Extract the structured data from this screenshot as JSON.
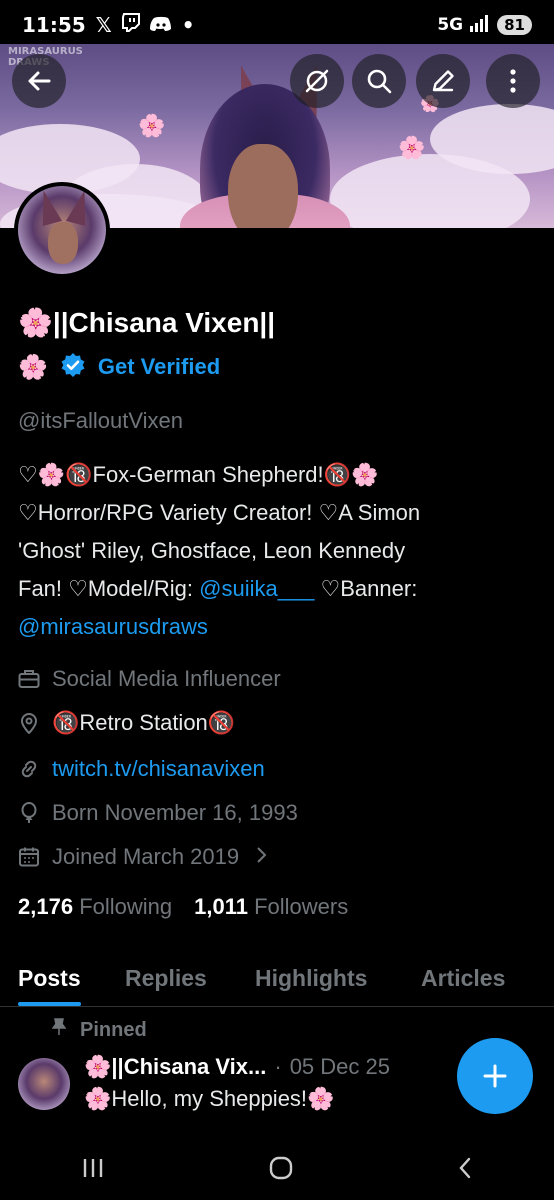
{
  "status_bar": {
    "time": "11:55",
    "network": "5G",
    "battery": "81"
  },
  "banner_watermark": "MIRASAURUS DRAWS",
  "profile": {
    "display_name": "🌸||Chisana Vixen||",
    "name_emoji": "🌸",
    "get_verified": "Get Verified",
    "handle": "@itsFalloutVixen",
    "bio": {
      "line1": "♡🌸🔞Fox-German Shepherd!🔞🌸",
      "line2": "♡Horror/RPG Variety Creator! ♡A Simon",
      "line3": "'Ghost' Riley, Ghostface, Leon Kennedy",
      "line4_pre": "Fan! ♡Model/Rig: ",
      "line4_link": "@suiika___",
      "line4_post": " ♡Banner:",
      "line5_link": "@mirasaurusdraws"
    },
    "category": "Social Media Influencer",
    "location": "🔞Retro Station🔞",
    "website": "twitch.tv/chisanavixen",
    "birthday": "Born November 16, 1993",
    "joined": "Joined March 2019",
    "following_count": "2,176",
    "following_label": "Following",
    "followers_count": "1,011",
    "followers_label": "Followers"
  },
  "tabs": [
    "Posts",
    "Replies",
    "Highlights",
    "Articles"
  ],
  "pinned": {
    "label": "Pinned",
    "author": "🌸||Chisana Vix...",
    "separator": "·",
    "date": "05 Dec 25",
    "text": "🌸Hello, my Sheppies!🌸"
  },
  "icons": {
    "back": "arrow-left-icon",
    "grok": "grok-icon",
    "search": "search-icon",
    "edit": "pencil-icon",
    "more": "more-vertical-icon",
    "fab": "plus-icon"
  },
  "colors": {
    "accent": "#1d9bf0",
    "background": "#000000",
    "muted": "#71767b"
  }
}
